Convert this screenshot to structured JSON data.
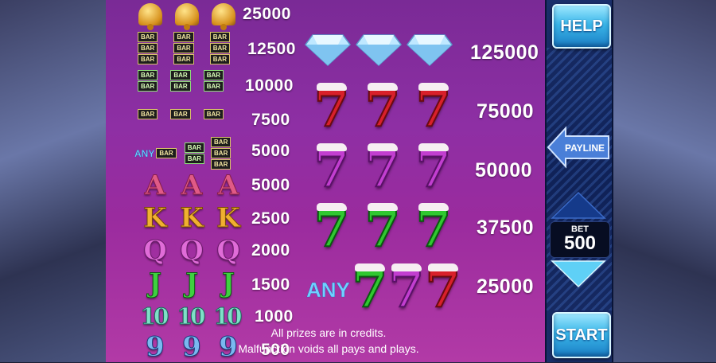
{
  "paytable": {
    "small_rows": [
      {
        "id": "bells",
        "value": "25000"
      },
      {
        "id": "triple-bar-mixed",
        "value": "12500"
      },
      {
        "id": "double-bar",
        "value": "10000"
      },
      {
        "id": "single-bar",
        "value": "7500"
      },
      {
        "id": "any-bar",
        "value": "5000",
        "any_label": "ANY"
      },
      {
        "id": "letter-a",
        "value": "5000",
        "symbol": "A"
      },
      {
        "id": "letter-k",
        "value": "2500",
        "symbol": "K"
      },
      {
        "id": "letter-q",
        "value": "2000",
        "symbol": "Q"
      },
      {
        "id": "letter-j",
        "value": "1500",
        "symbol": "J"
      },
      {
        "id": "ten",
        "value": "1000",
        "symbol": "10"
      },
      {
        "id": "nine",
        "value": "500",
        "symbol": "9"
      }
    ],
    "bar_label": "BAR",
    "big_rows": [
      {
        "id": "diamonds",
        "value": "125000"
      },
      {
        "id": "red-sevens",
        "value": "75000",
        "symbol": "7"
      },
      {
        "id": "purple-sevens",
        "value": "50000",
        "symbol": "7"
      },
      {
        "id": "green-sevens",
        "value": "37500",
        "symbol": "7"
      },
      {
        "id": "any-sevens",
        "value": "25000",
        "any_label": "ANY",
        "symbol": "7"
      }
    ],
    "note_line1": "All prizes are in credits.",
    "note_line2": "Malfunction voids all pays and plays."
  },
  "side_panel": {
    "help_label": "HELP",
    "payline_label": "PAYLINE",
    "bet_label": "BET",
    "bet_value": "500",
    "start_label": "START"
  },
  "colors": {
    "paytable_bg": "#8e2fa4",
    "button_blue": "#3ab6e8",
    "panel_navy": "#10235a"
  }
}
